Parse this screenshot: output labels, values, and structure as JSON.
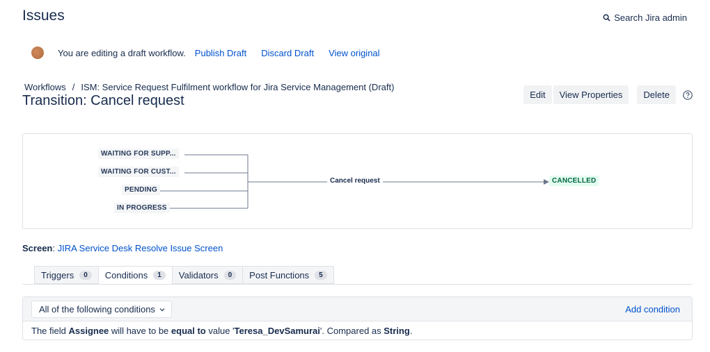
{
  "app": {
    "title": "Issues",
    "search_admin": "Search Jira admin"
  },
  "draft_bar": {
    "message": "You are editing a draft workflow.",
    "publish": "Publish Draft",
    "discard": "Discard Draft",
    "view_original": "View original"
  },
  "breadcrumb": {
    "root": "Workflows",
    "separator": "/",
    "current": "ISM: Service Request Fulfilment workflow for Jira Service Management (Draft)"
  },
  "page_title": "Transition: Cancel request",
  "actions": {
    "edit": "Edit",
    "view_properties": "View Properties",
    "delete": "Delete"
  },
  "diagram": {
    "from_statuses": [
      "WAITING FOR SUPP...",
      "WAITING FOR CUST...",
      "PENDING",
      "IN PROGRESS"
    ],
    "transition": "Cancel request",
    "to_status": "CANCELLED"
  },
  "screen": {
    "label": "Screen",
    "value": "JIRA Service Desk Resolve Issue Screen"
  },
  "tabs": [
    {
      "label": "Triggers",
      "count": "0"
    },
    {
      "label": "Conditions",
      "count": "1"
    },
    {
      "label": "Validators",
      "count": "0"
    },
    {
      "label": "Post Functions",
      "count": "5"
    }
  ],
  "conditions": {
    "selector": "All of the following conditions",
    "add": "Add condition",
    "rule": {
      "p1": "The field ",
      "field": "Assignee",
      "p2": " will have to be ",
      "operator": "equal to",
      "p3": " value '",
      "value": "Teresa_DevSamurai",
      "p4": "'. Compared as ",
      "type": "String",
      "p5": "."
    }
  },
  "colors": {
    "link": "#0052cc",
    "text": "#172b4d",
    "done_status": "#006644"
  }
}
